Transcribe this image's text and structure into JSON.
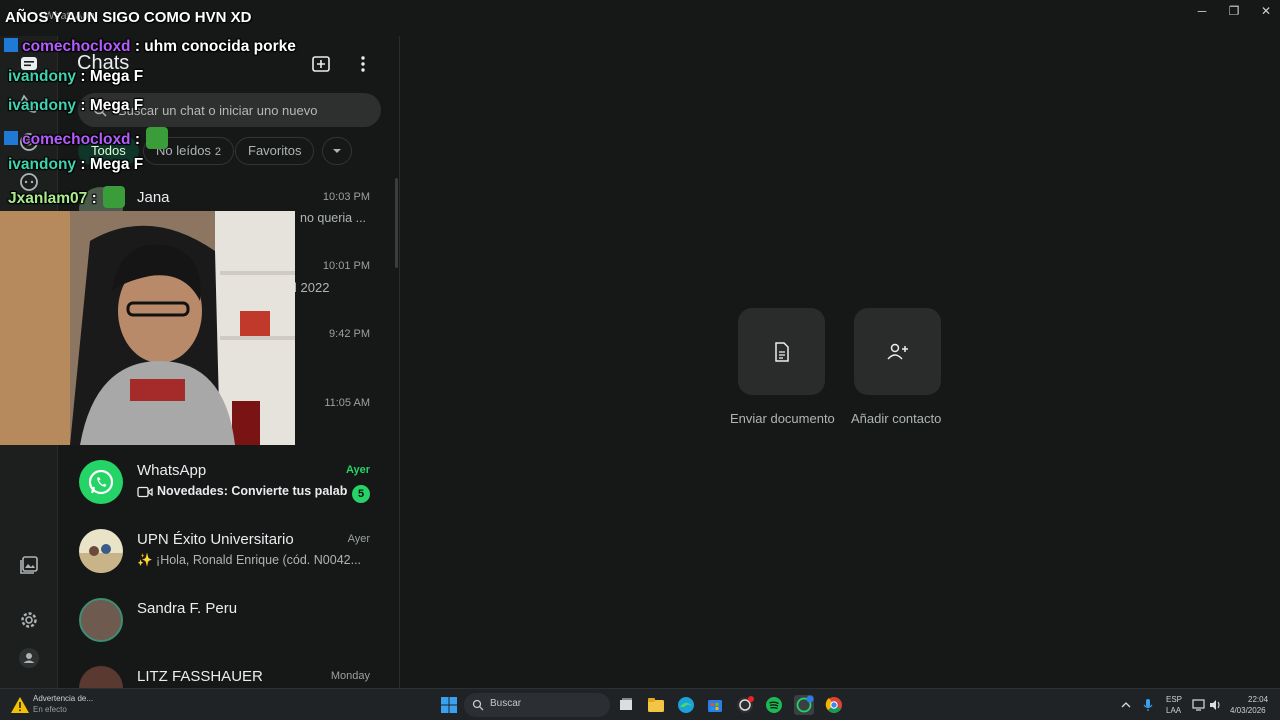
{
  "window": {
    "title": "WhatsApp",
    "controls": {
      "minimize": "─",
      "maximize": "❐",
      "close": "✕"
    }
  },
  "chat_panel": {
    "title": "Chats",
    "search_placeholder": "Buscar un chat o iniciar uno nuevo",
    "filters": [
      {
        "label": "Todos",
        "active": true
      },
      {
        "label": "No leídos",
        "count": "2"
      },
      {
        "label": "Favoritos"
      }
    ],
    "chats": [
      {
        "name": "Jana",
        "time": "10:03 PM",
        "preview": "no queria ..."
      },
      {
        "name": "",
        "time": "10:01 PM",
        "preview": "l 2022"
      },
      {
        "name": "",
        "time": "9:42 PM",
        "preview": ""
      },
      {
        "name": "",
        "time": "11:05 AM",
        "preview": ""
      },
      {
        "name": "WhatsApp",
        "time": "Ayer",
        "preview": "Novedades: Convierte tus palab...",
        "unread": "5"
      },
      {
        "name": "UPN Éxito Universitario",
        "time": "Ayer",
        "preview": "✨ ¡Hola,  Ronald Enrique (cód. N0042..."
      },
      {
        "name": "Sandra F. Peru",
        "time": "",
        "preview": ""
      },
      {
        "name": "LITZ FASSHAUER",
        "time": "Monday",
        "preview": ""
      }
    ]
  },
  "main_pane": {
    "actions": [
      {
        "label": "Enviar documento",
        "icon": "document-icon"
      },
      {
        "label": "Añadir contacto",
        "icon": "add-contact-icon"
      }
    ]
  },
  "stream_overlay": {
    "title": "AÑOS Y AUN SIGO COMO HVN XD",
    "messages": [
      {
        "user": "comechocloxd",
        "text": " : uhm conocida porke",
        "color": "purple",
        "badge": true
      },
      {
        "user": "ivandony",
        "text": " : Mega F",
        "color": "teal"
      },
      {
        "user": "ivandony",
        "text": " : Mega F",
        "color": "teal"
      },
      {
        "user": "comechocloxd",
        "text": " : ",
        "color": "purple",
        "badge": true,
        "emote": true
      },
      {
        "user": "ivandony",
        "text": " : Mega F",
        "color": "teal"
      },
      {
        "user": "Jxanlam07",
        "text": " : ",
        "color": "lime",
        "emote": true
      }
    ]
  },
  "taskbar": {
    "notification_title": "Advertencia de...",
    "notification_sub": "En efecto",
    "search_label": "Buscar",
    "lang_top": "ESP",
    "lang_bottom": "LAA",
    "time": "22:04",
    "date": "4/03/2026"
  },
  "colors": {
    "accent_green": "#25d366",
    "background": "#161717",
    "rail": "#1d1f1f"
  }
}
